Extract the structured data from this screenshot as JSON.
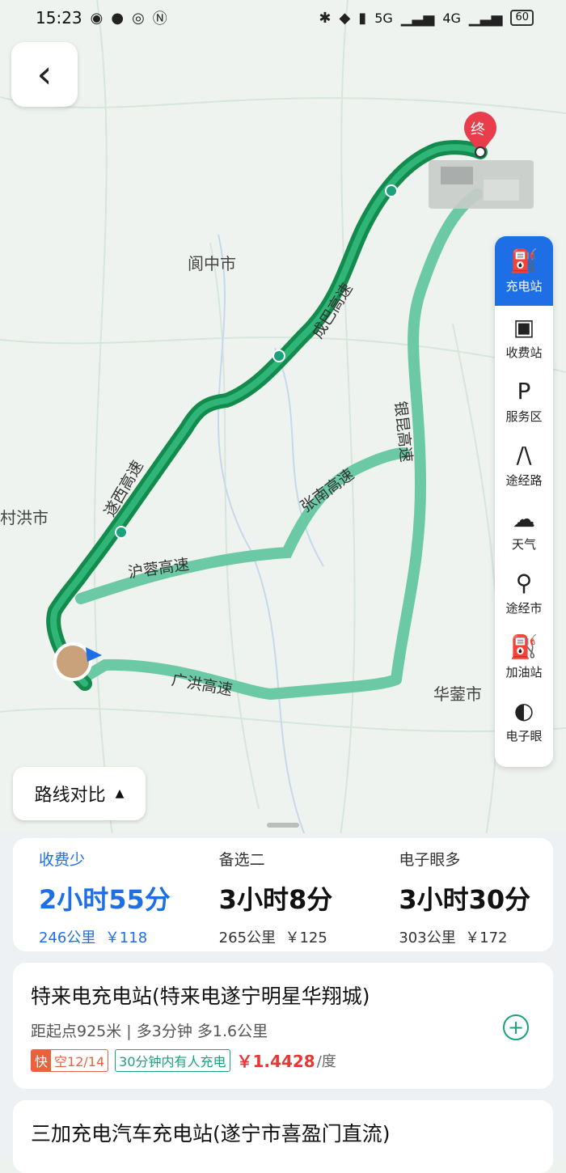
{
  "status": {
    "time": "15:23",
    "battery": "60",
    "signal_a": "5G",
    "signal_b": "4G"
  },
  "nav": {
    "back_icon": "chevron-left-icon"
  },
  "map": {
    "cities": {
      "langzhong": "阆中市",
      "huaying": "华蓥市",
      "partial_city": "村洪市"
    },
    "roads": {
      "chengba": "成巴高速",
      "suixi": "遂西高速",
      "hurong": "沪蓉高速",
      "zhangnan": "张南高速",
      "guanghong": "广洪高速",
      "yinkun": "银昆高速"
    },
    "end_marker": "终"
  },
  "toolbar": [
    {
      "label": "充电站",
      "icon": "charging-station-icon",
      "active": true
    },
    {
      "label": "收费站",
      "icon": "toll-station-icon",
      "active": false
    },
    {
      "label": "服务区",
      "icon": "service-area-icon",
      "active": false
    },
    {
      "label": "途经路",
      "icon": "road-icon",
      "active": false
    },
    {
      "label": "天气",
      "icon": "weather-cloud-icon",
      "active": false
    },
    {
      "label": "途经市",
      "icon": "city-pin-icon",
      "active": false
    },
    {
      "label": "加油站",
      "icon": "gas-station-icon",
      "active": false
    },
    {
      "label": "电子眼",
      "icon": "camera-icon",
      "active": false
    }
  ],
  "compare": {
    "label": "路线对比"
  },
  "routes": [
    {
      "tag": "收费少",
      "time": "2小时55分",
      "distance": "246公里",
      "cost": "￥118"
    },
    {
      "tag": "备选二",
      "time": "3小时8分",
      "distance": "265公里",
      "cost": "￥125"
    },
    {
      "tag": "电子眼多",
      "time": "3小时30分",
      "distance": "303公里",
      "cost": "￥172"
    }
  ],
  "stations": [
    {
      "name": "特来电充电站(特来电遂宁明星华翔城)",
      "meta": "距起点925米 | 多3分钟 多1.6公里",
      "fast_label": "快",
      "availability": "空12/14",
      "note": "30分钟内有人充电",
      "price": "￥1.4428",
      "unit": "/度"
    },
    {
      "name": "三加充电汽车充电站(遂宁市喜盈门直流)"
    }
  ],
  "colors": {
    "accent": "#1e6fe6",
    "route_main": "#138a4c",
    "route_alt": "#5cc0a0",
    "price": "#e53935"
  }
}
